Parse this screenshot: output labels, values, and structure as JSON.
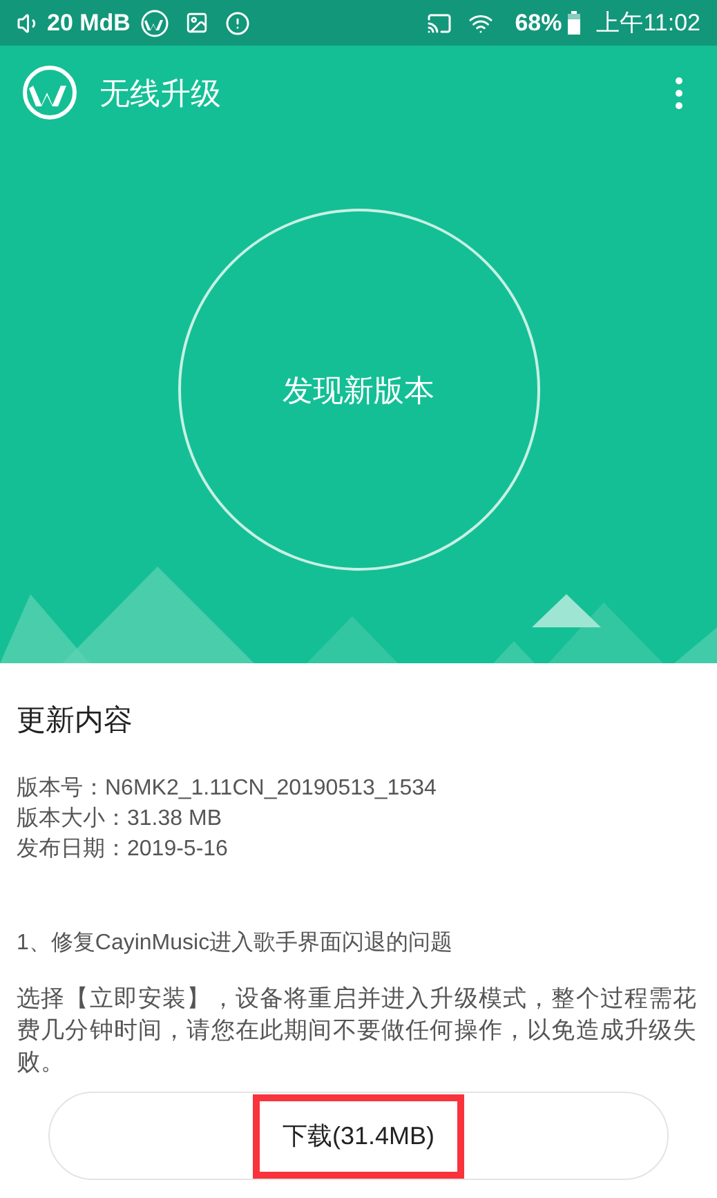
{
  "status_bar": {
    "volume": "20 MdB",
    "battery": "68%",
    "time": "上午11:02"
  },
  "app_bar": {
    "title": "无线升级"
  },
  "hero": {
    "status": "发现新版本"
  },
  "content": {
    "heading": "更新内容",
    "info": [
      "版本号：N6MK2_1.11CN_20190513_1534",
      "版本大小：31.38 MB",
      "发布日期：2019-5-16"
    ],
    "notes": [
      "1、修复CayinMusic进入歌手界面闪退的问题"
    ],
    "instructions": "选择【立即安装】，设备将重启并进入升级模式，整个过程需花费几分钟时间，请您在此期间不要做任何操作，以免造成升级失败。"
  },
  "download_button": {
    "label": "下载(31.4MB)",
    "highlighted": true
  }
}
